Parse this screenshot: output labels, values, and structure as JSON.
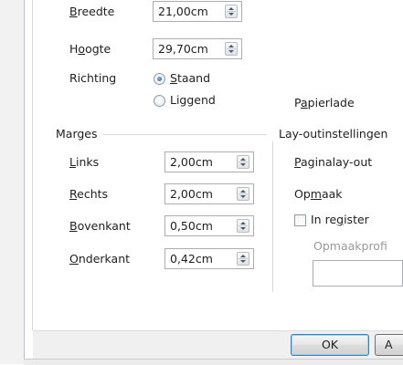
{
  "paper": {
    "width_label_parts": [
      "",
      "B",
      "reedte"
    ],
    "width_value": "21,00cm",
    "height_label_parts": [
      "H",
      "o",
      "ogte"
    ],
    "height_value": "29,70cm",
    "orientation_label": "Richting",
    "portrait_parts": [
      "",
      "S",
      "taand"
    ],
    "landscape_label": "Liggend",
    "tray_label_parts": [
      "P",
      "a",
      "pierlade"
    ]
  },
  "margins": {
    "section_title": "Marges",
    "left_label_parts": [
      "",
      "L",
      "inks"
    ],
    "left_value": "2,00cm",
    "right_label_parts": [
      "",
      "R",
      "echts"
    ],
    "right_value": "2,00cm",
    "top_label_parts": [
      "",
      "B",
      "ovenkant"
    ],
    "top_value": "0,50cm",
    "bottom_label_parts": [
      "",
      "O",
      "nderkant"
    ],
    "bottom_value": "0,42cm"
  },
  "layout": {
    "section_title": "Lay-outinstellingen",
    "page_layout_parts": [
      "",
      "P",
      "aginalay-out"
    ],
    "format_parts": [
      "Op",
      "m",
      "aak"
    ],
    "register_parts": [
      "In re",
      "g",
      "ister"
    ],
    "reference_label": "Opmaakprofi"
  },
  "buttons": {
    "ok_label": "OK",
    "next_label": "A"
  }
}
